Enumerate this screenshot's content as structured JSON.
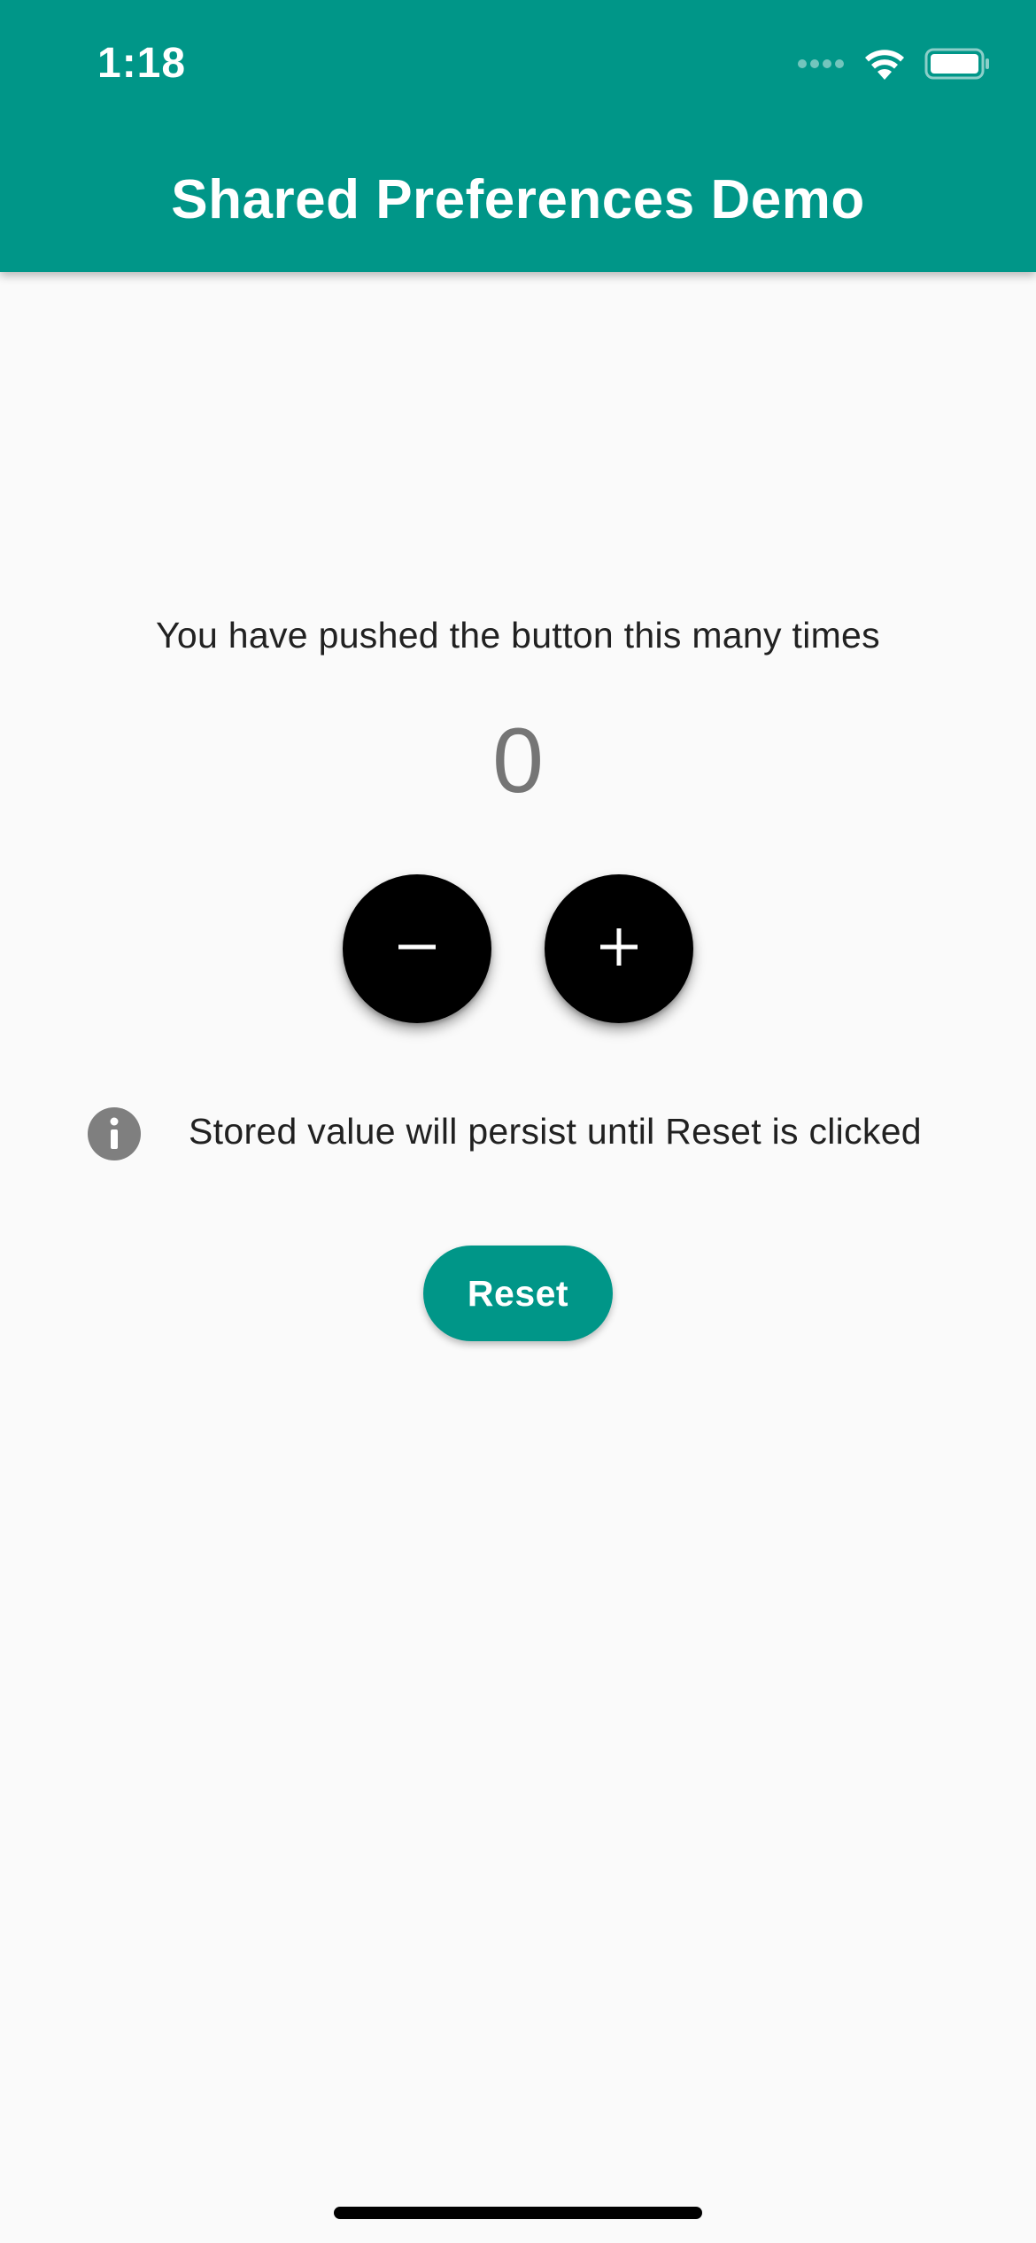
{
  "status_bar": {
    "time": "1:18"
  },
  "app_bar": {
    "title": "Shared Preferences Demo",
    "color": "#009688"
  },
  "counter": {
    "caption": "You have pushed the button this many times",
    "value": "0"
  },
  "buttons": {
    "decrement_icon": "minus-icon",
    "increment_icon": "plus-icon",
    "reset_label": "Reset"
  },
  "info": {
    "icon": "info-icon",
    "text": "Stored value will persist until Reset is clicked"
  },
  "colors": {
    "accent": "#009688",
    "fab": "#000000",
    "background": "#fafafa",
    "counter_text": "#757575",
    "info_icon": "#7f7f7f"
  }
}
